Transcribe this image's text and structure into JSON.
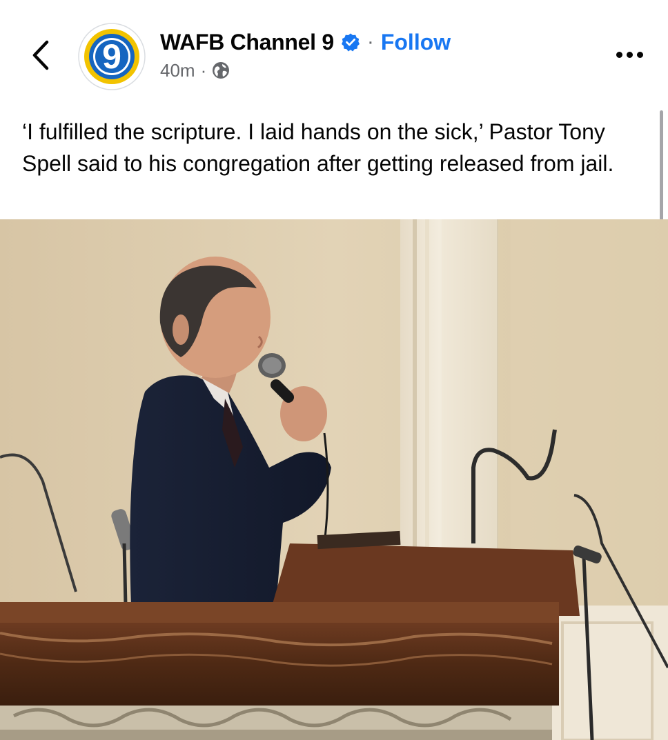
{
  "post": {
    "page_name": "WAFB Channel 9",
    "follow_label": "Follow",
    "separator": "·",
    "timestamp": "40m",
    "meta_separator": "·",
    "caption": "‘I fulfilled the scripture. I laid hands on the sick,’ Pastor Tony Spell said to his congregation after getting released from jail.",
    "avatar_text": "9"
  },
  "icons": {
    "back": "chevron-left-icon",
    "verified": "verified-badge-icon",
    "audience": "globe-icon",
    "more": "more-options-icon"
  },
  "colors": {
    "accent": "#1877f2",
    "secondary_text": "#65676b",
    "logo_blue": "#1565c0",
    "logo_gold": "#f2c300"
  }
}
